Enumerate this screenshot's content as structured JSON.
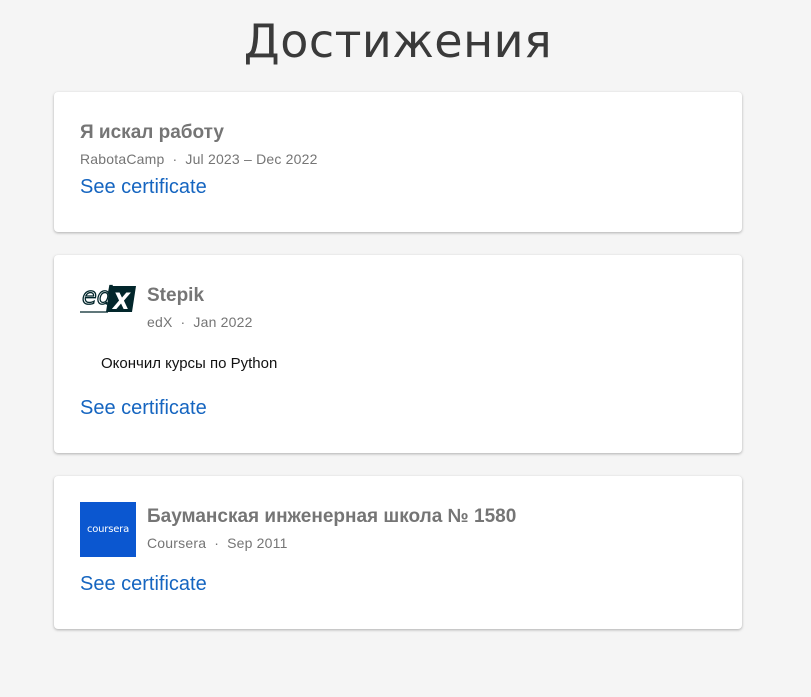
{
  "page": {
    "title": "Достижения"
  },
  "certificates": [
    {
      "title": "Я искал работу",
      "issuer": "RabotaCamp",
      "separator": "·",
      "date": "Jul 2023 – Dec 2022",
      "description": "",
      "logo": null,
      "link_label": "See certificate"
    },
    {
      "title": "Stepik",
      "issuer": "edX",
      "separator": "·",
      "date": "Jan 2022",
      "description": "Окончил курсы по Python",
      "logo": {
        "icon": "edx-logo-icon",
        "text_ed": "ed",
        "text_x": "X",
        "color": "#02262b"
      },
      "link_label": "See certificate"
    },
    {
      "title": "Бауманская инженерная школа № 1580",
      "issuer": "Coursera",
      "separator": "·",
      "date": "Sep 2011",
      "description": "",
      "logo": {
        "icon": "coursera-logo-icon",
        "text": "coursera",
        "color": "#0b57d0"
      },
      "link_label": "See certificate"
    }
  ],
  "colors": {
    "background": "#f5f5f5",
    "card": "#ffffff",
    "title_text": "#757575",
    "link": "#1565c0",
    "heading": "#3a3a3a"
  }
}
